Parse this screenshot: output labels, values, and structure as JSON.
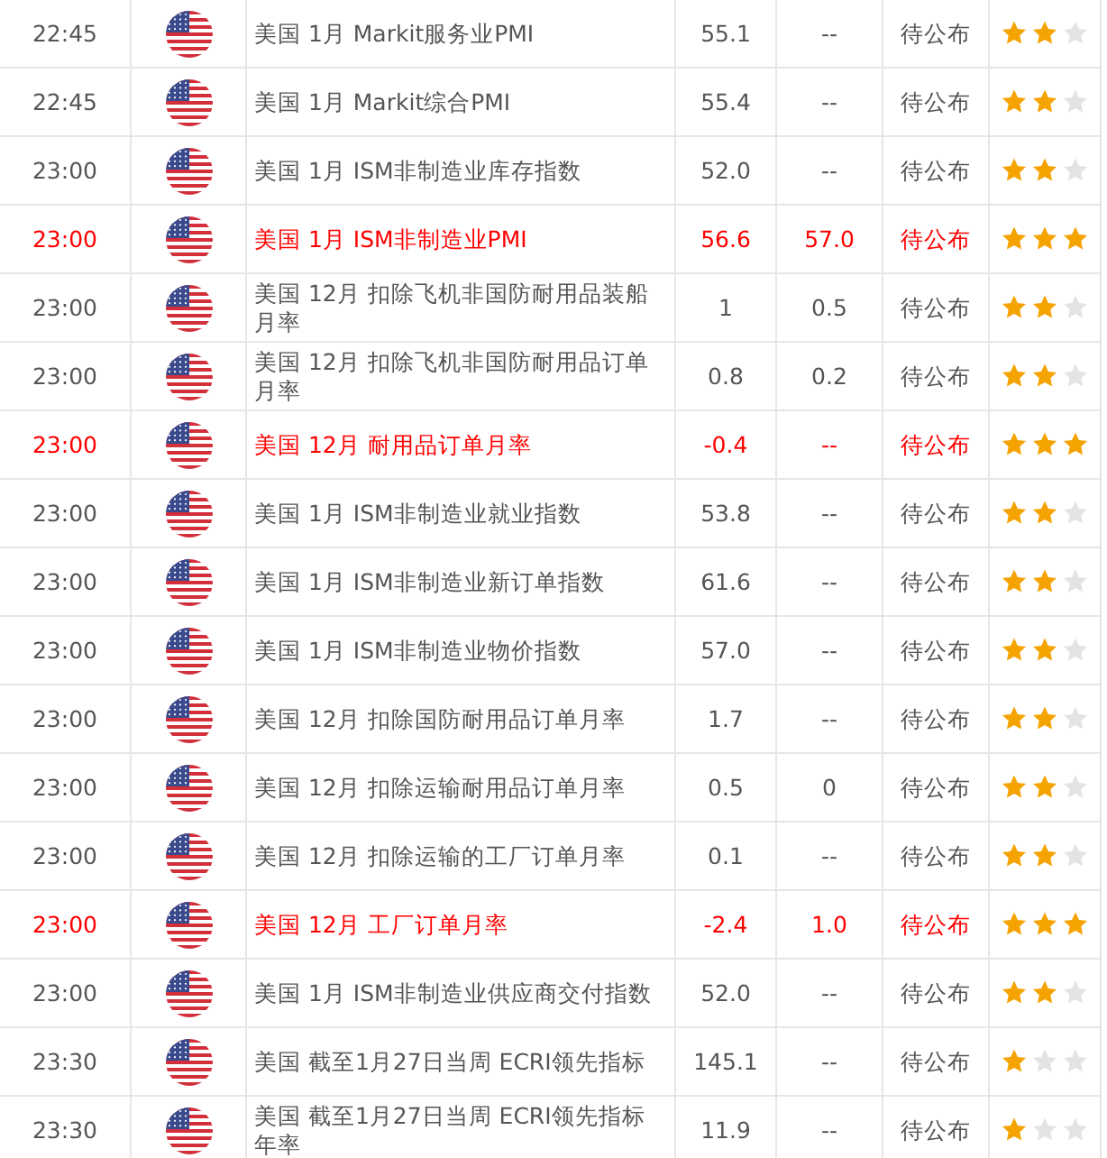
{
  "rows": [
    {
      "time": "22:45",
      "event": "美国 1月 Markit服务业PMI",
      "previous": "55.1",
      "forecast": "--",
      "status": "待公布",
      "stars": 2,
      "highlight": false
    },
    {
      "time": "22:45",
      "event": "美国 1月 Markit综合PMI",
      "previous": "55.4",
      "forecast": "--",
      "status": "待公布",
      "stars": 2,
      "highlight": false
    },
    {
      "time": "23:00",
      "event": "美国 1月 ISM非制造业库存指数",
      "previous": "52.0",
      "forecast": "--",
      "status": "待公布",
      "stars": 2,
      "highlight": false
    },
    {
      "time": "23:00",
      "event": "美国 1月 ISM非制造业PMI",
      "previous": "56.6",
      "forecast": "57.0",
      "status": "待公布",
      "stars": 3,
      "highlight": true
    },
    {
      "time": "23:00",
      "event": "美国 12月 扣除飞机非国防耐用品装船月率",
      "previous": "1",
      "forecast": "0.5",
      "status": "待公布",
      "stars": 2,
      "highlight": false
    },
    {
      "time": "23:00",
      "event": "美国 12月 扣除飞机非国防耐用品订单月率",
      "previous": "0.8",
      "forecast": "0.2",
      "status": "待公布",
      "stars": 2,
      "highlight": false
    },
    {
      "time": "23:00",
      "event": "美国 12月 耐用品订单月率",
      "previous": "-0.4",
      "forecast": "--",
      "status": "待公布",
      "stars": 3,
      "highlight": true
    },
    {
      "time": "23:00",
      "event": "美国 1月 ISM非制造业就业指数",
      "previous": "53.8",
      "forecast": "--",
      "status": "待公布",
      "stars": 2,
      "highlight": false
    },
    {
      "time": "23:00",
      "event": "美国 1月 ISM非制造业新订单指数",
      "previous": "61.6",
      "forecast": "--",
      "status": "待公布",
      "stars": 2,
      "highlight": false
    },
    {
      "time": "23:00",
      "event": "美国 1月 ISM非制造业物价指数",
      "previous": "57.0",
      "forecast": "--",
      "status": "待公布",
      "stars": 2,
      "highlight": false
    },
    {
      "time": "23:00",
      "event": "美国 12月 扣除国防耐用品订单月率",
      "previous": "1.7",
      "forecast": "--",
      "status": "待公布",
      "stars": 2,
      "highlight": false
    },
    {
      "time": "23:00",
      "event": "美国 12月 扣除运输耐用品订单月率",
      "previous": "0.5",
      "forecast": "0",
      "status": "待公布",
      "stars": 2,
      "highlight": false
    },
    {
      "time": "23:00",
      "event": "美国 12月 扣除运输的工厂订单月率",
      "previous": "0.1",
      "forecast": "--",
      "status": "待公布",
      "stars": 2,
      "highlight": false
    },
    {
      "time": "23:00",
      "event": "美国 12月 工厂订单月率",
      "previous": "-2.4",
      "forecast": "1.0",
      "status": "待公布",
      "stars": 3,
      "highlight": true
    },
    {
      "time": "23:00",
      "event": "美国 1月 ISM非制造业供应商交付指数",
      "previous": "52.0",
      "forecast": "--",
      "status": "待公布",
      "stars": 2,
      "highlight": false
    },
    {
      "time": "23:30",
      "event": "美国 截至1月27日当周 ECRI领先指标",
      "previous": "145.1",
      "forecast": "--",
      "status": "待公布",
      "stars": 1,
      "highlight": false
    },
    {
      "time": "23:30",
      "event": "美国 截至1月27日当周 ECRI领先指标年率",
      "previous": "11.9",
      "forecast": "--",
      "status": "待公布",
      "stars": 1,
      "highlight": false
    }
  ]
}
